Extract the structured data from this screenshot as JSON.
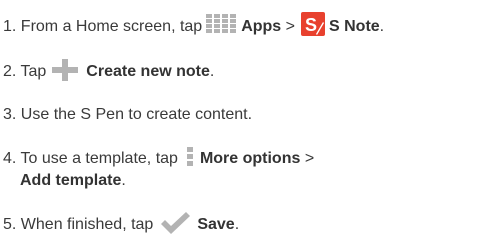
{
  "steps": [
    {
      "num": "1.",
      "text": "From a Home screen, tap",
      "apps_label": "Apps",
      "sep": ">",
      "snote_label": "S Note",
      "end": "."
    },
    {
      "num": "2.",
      "text": "Tap",
      "label": "Create new note",
      "end": "."
    },
    {
      "num": "3.",
      "text": "Use the S Pen to create content."
    },
    {
      "num": "4.",
      "text": "To use a template, tap",
      "label": "More options",
      "sep": ">",
      "label2": "Add template",
      "end": "."
    },
    {
      "num": "5.",
      "text": "When finished, tap",
      "label": "Save",
      "end": "."
    }
  ],
  "icons": {
    "apps": "apps-grid-icon",
    "snote": "s-note-icon",
    "create": "plus-icon",
    "more": "more-options-icon",
    "save": "check-icon"
  },
  "colors": {
    "text": "#3a3a3a",
    "icon_gray": "#b3b3b3",
    "snote_red": "#e8412e"
  }
}
